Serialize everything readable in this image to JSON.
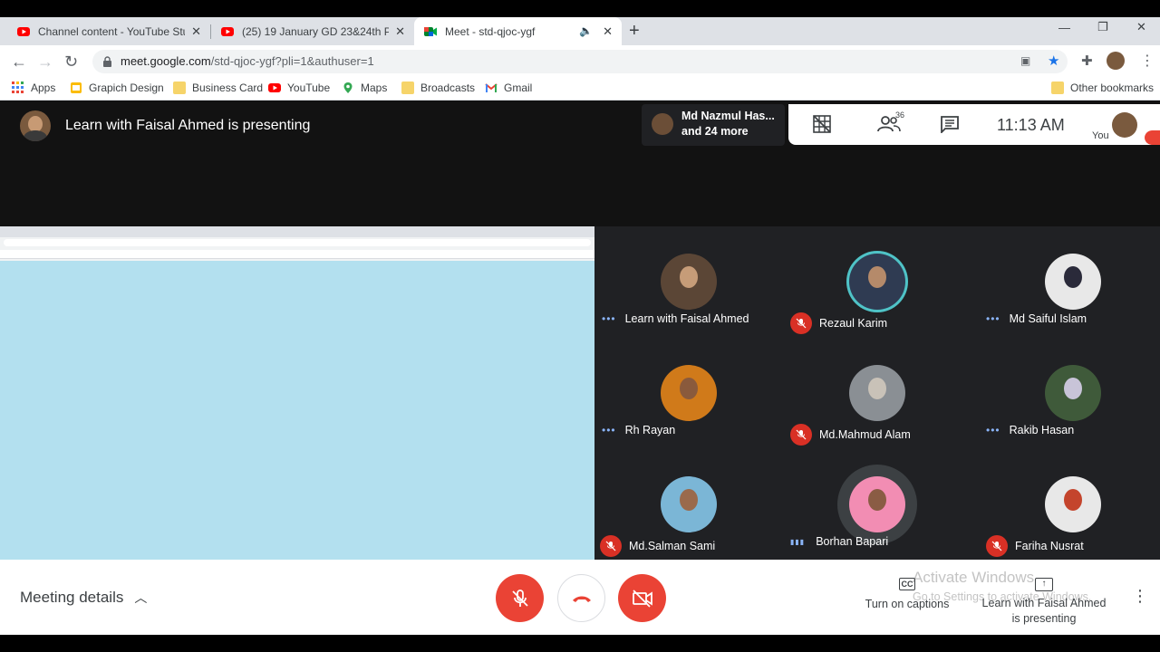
{
  "browser": {
    "tabs": [
      {
        "title": "Channel content - YouTube Studi",
        "favicon": "youtube-icon"
      },
      {
        "title": "(25) 19 January GD 23&24th Plat",
        "favicon": "youtube-icon"
      },
      {
        "title": "Meet - std-qjoc-ygf",
        "favicon": "meet-icon",
        "active": true
      }
    ],
    "url_host": "meet.google.com",
    "url_path": "/std-qjoc-ygf?pli=1&authuser=1",
    "bookmarks": [
      "Apps",
      "Grapich Design",
      "Business Card",
      "YouTube",
      "Maps",
      "Broadcasts",
      "Gmail"
    ],
    "other_bookmarks": "Other bookmarks"
  },
  "meet": {
    "presenting_title": "Learn with Faisal Ahmed is presenting",
    "pinned_name": "Md Nazmul Has...",
    "pinned_more": "and 24 more",
    "participants_count": "36",
    "clock": "11:13 AM",
    "you_label": "You",
    "participants": [
      {
        "name": "Learn with Faisal Ahmed",
        "status": "dots"
      },
      {
        "name": "Rezaul Karim",
        "status": "muted"
      },
      {
        "name": "Md Saiful Islam",
        "status": "dots"
      },
      {
        "name": "Rh Rayan",
        "status": "dots"
      },
      {
        "name": "Md.Mahmud Alam",
        "status": "muted"
      },
      {
        "name": "Rakib Hasan",
        "status": "dots"
      },
      {
        "name": "Md.Salman Sami",
        "status": "muted"
      },
      {
        "name": "Borhan Bapari",
        "status": "speaking"
      },
      {
        "name": "Fariha Nusrat",
        "status": "muted"
      }
    ],
    "bottom": {
      "meeting_details": "Meeting details",
      "captions_label": "Turn on captions",
      "present_line1": "Learn with Faisal Ahmed",
      "present_line2": "is presenting",
      "watermark_title": "Activate Windows",
      "watermark_sub": "Go to Settings to activate Windows."
    }
  },
  "colors": {
    "red": "#ea4335",
    "meet_bg": "#121212",
    "grid_bg": "#202124",
    "screen_bg": "#b3e0ef"
  }
}
